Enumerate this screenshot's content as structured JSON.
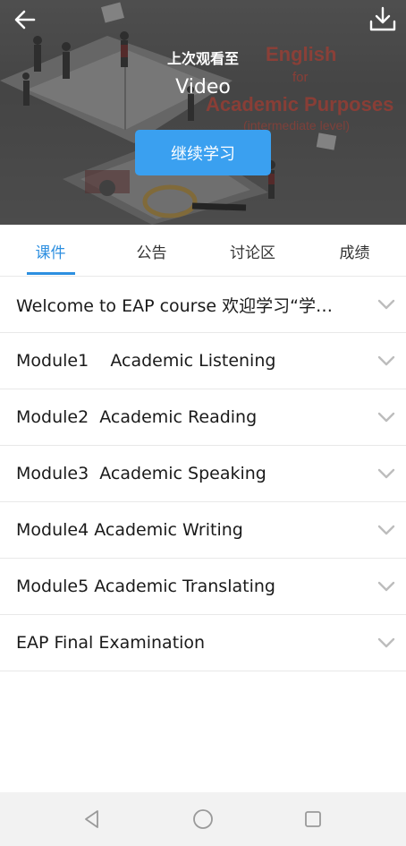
{
  "banner": {
    "last_watched_label": "上次观看至",
    "video_title": "Video",
    "continue_button": "继续学习",
    "overlay": {
      "english": "English",
      "for": "for",
      "academic_purposes": "Academic Purposes",
      "level": "(intermediate level)"
    }
  },
  "tabs": [
    {
      "label": "课件",
      "active": true
    },
    {
      "label": "公告",
      "active": false
    },
    {
      "label": "讨论区",
      "active": false
    },
    {
      "label": "成绩",
      "active": false
    }
  ],
  "modules": [
    {
      "label": "Welcome to EAP course 欢迎学习“学…"
    },
    {
      "label": "Module1    Academic Listening"
    },
    {
      "label": "Module2  Academic Reading"
    },
    {
      "label": "Module3  Academic Speaking"
    },
    {
      "label": "Module4 Academic Writing"
    },
    {
      "label": "Module5 Academic Translating"
    },
    {
      "label": "EAP Final Examination"
    }
  ],
  "colors": {
    "accent": "#2d8fe0",
    "button": "#3aa0f0",
    "divider": "#e8e8e8"
  }
}
